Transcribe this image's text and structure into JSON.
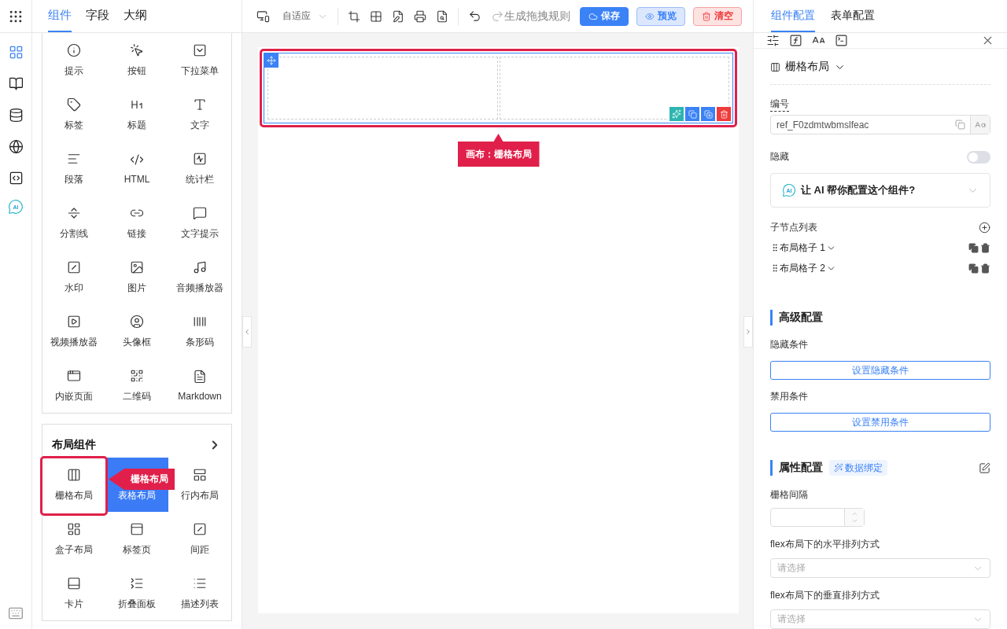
{
  "rail": {
    "items": [
      {
        "selected": true
      },
      {
        "selected": false
      },
      {
        "selected": false
      },
      {
        "selected": false
      },
      {
        "selected": false
      },
      {
        "selected": false
      }
    ],
    "ai_label": "AI"
  },
  "left_tabs": [
    {
      "label": "组件",
      "selected": true
    },
    {
      "label": "字段",
      "selected": false
    },
    {
      "label": "大纲",
      "selected": false
    }
  ],
  "basic_components": [
    "提示",
    "按钮",
    "下拉菜单",
    "标签",
    "标题",
    "文字",
    "段落",
    "HTML",
    "统计栏",
    "分割线",
    "链接",
    "文字提示",
    "水印",
    "图片",
    "音频播放器",
    "视频播放器",
    "头像框",
    "条形码",
    "内嵌页面",
    "二维码",
    "Markdown"
  ],
  "layout_group": {
    "title": "布局组件",
    "items": [
      {
        "label": "栅格布局",
        "selected": false
      },
      {
        "label": "表格布局",
        "selected": true
      },
      {
        "label": "行内布局",
        "selected": false
      },
      {
        "label": "盒子布局",
        "selected": false
      },
      {
        "label": "标签页",
        "selected": false
      },
      {
        "label": "间距",
        "selected": false
      },
      {
        "label": "卡片",
        "selected": false
      },
      {
        "label": "折叠面板",
        "selected": false
      },
      {
        "label": "描述列表",
        "selected": false
      }
    ]
  },
  "toolbar": {
    "mode": "自适应",
    "redo_disabled": true,
    "generate_rule": "生成拖拽规则",
    "save": "保存",
    "preview": "预览",
    "clear": "清空"
  },
  "canvas": {
    "selected": true,
    "callout": "画布：栅格布局"
  },
  "left_callout": "栅格布局",
  "right": {
    "tabs": [
      {
        "label": "组件配置",
        "selected": true
      },
      {
        "label": "表单配置",
        "selected": false
      }
    ],
    "component_type": "栅格布局",
    "id_label": "编号",
    "id_value": "ref_F0zdmtwbmslfeac",
    "hidden_label": "隐藏",
    "hidden_on": false,
    "ai_label": "AI",
    "ai_prompt": "让 AI 帮你配置这个组件?",
    "children_title": "子节点列表",
    "children": [
      "布局格子 1",
      "布局格子 2"
    ],
    "advanced_title": "高级配置",
    "hide_condition_label": "隐藏条件",
    "hide_condition_button": "设置隐藏条件",
    "disable_condition_label": "禁用条件",
    "disable_condition_button": "设置禁用条件",
    "props_title": "属性配置",
    "data_binding": "数据绑定",
    "gutter_label": "栅格间隔",
    "selects": [
      {
        "label": "flex布局下的水平排列方式",
        "placeholder": "请选择"
      },
      {
        "label": "flex布局下的垂直排列方式",
        "placeholder": "请选择"
      }
    ]
  }
}
